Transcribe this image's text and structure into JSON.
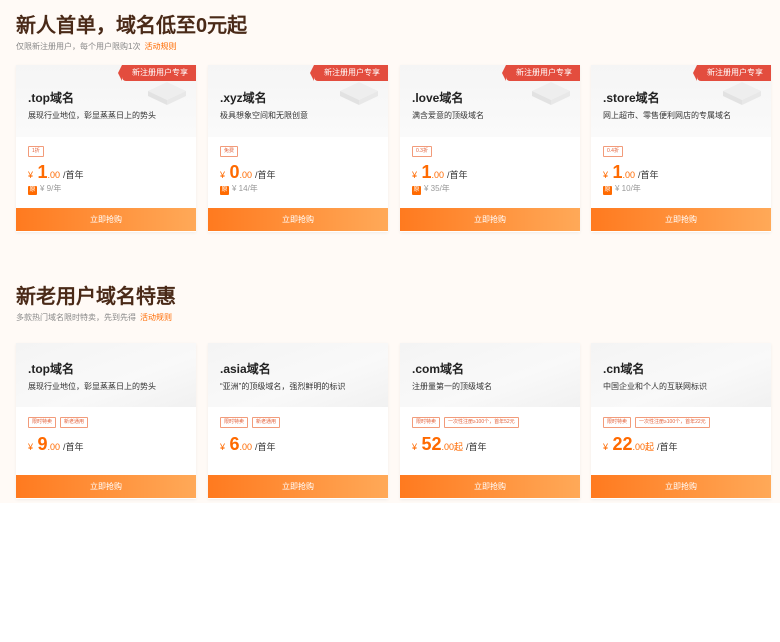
{
  "section1": {
    "title": "新人首单，域名低至0元起",
    "subtitle": "仅限新注册用户，每个用户限购1次",
    "rules_link": "活动规则",
    "ribbon": "新注册用户专享",
    "cards": [
      {
        "name": ".top域名",
        "desc": "展现行业地位，彰显蒸蒸日上的势头",
        "tag": "1折",
        "currency": "¥",
        "price_int": "1",
        "price_dec": ".00",
        "unit": "/首年",
        "orig_badge": "原",
        "orig": "¥ 9/年",
        "buy": "立即抢购"
      },
      {
        "name": ".xyz域名",
        "desc": "极具想象空间和无限创意",
        "tag": "免费",
        "currency": "¥",
        "price_int": "0",
        "price_dec": ".00",
        "unit": "/首年",
        "orig_badge": "原",
        "orig": "¥ 14/年",
        "buy": "立即抢购"
      },
      {
        "name": ".love域名",
        "desc": "满含爱意的顶级域名",
        "tag": "0.3折",
        "currency": "¥",
        "price_int": "1",
        "price_dec": ".00",
        "unit": "/首年",
        "orig_badge": "原",
        "orig": "¥ 35/年",
        "buy": "立即抢购"
      },
      {
        "name": ".store域名",
        "desc": "网上超市、零售便利网店的专属域名",
        "tag": "0.4折",
        "currency": "¥",
        "price_int": "1",
        "price_dec": ".00",
        "unit": "/首年",
        "orig_badge": "原",
        "orig": "¥ 10/年",
        "buy": "立即抢购"
      }
    ]
  },
  "section2": {
    "title": "新老用户域名特惠",
    "subtitle": "多款热门域名限时特卖，先到先得",
    "rules_link": "活动规则",
    "cards": [
      {
        "name": ".top域名",
        "desc": "展现行业地位，彰显蒸蒸日上的势头",
        "tags": [
          "限时特卖",
          "新老通用"
        ],
        "currency": "¥",
        "price_int": "9",
        "price_dec": ".00",
        "unit": "/首年",
        "buy": "立即抢购"
      },
      {
        "name": ".asia域名",
        "desc": "“亚洲”的顶级域名，强烈鲜明的标识",
        "tags": [
          "限时特卖",
          "新老通用"
        ],
        "currency": "¥",
        "price_int": "6",
        "price_dec": ".00",
        "unit": "/首年",
        "buy": "立即抢购"
      },
      {
        "name": ".com域名",
        "desc": "注册量第一的顶级域名",
        "tags": [
          "限时特卖",
          "一次性注册≥100个，首年52元"
        ],
        "currency": "¥",
        "price_int": "52",
        "price_dec": ".00起",
        "unit": "/首年",
        "buy": "立即抢购"
      },
      {
        "name": ".cn域名",
        "desc": "中国企业和个人的互联网标识",
        "tags": [
          "限时特卖",
          "一次性注册≥100个，首年22元"
        ],
        "currency": "¥",
        "price_int": "22",
        "price_dec": ".00起",
        "unit": "/首年",
        "buy": "立即抢购"
      }
    ]
  },
  "colors": {
    "accent": "#ff6a00",
    "ribbon": "#e34d3e",
    "title": "#4a2a18"
  }
}
